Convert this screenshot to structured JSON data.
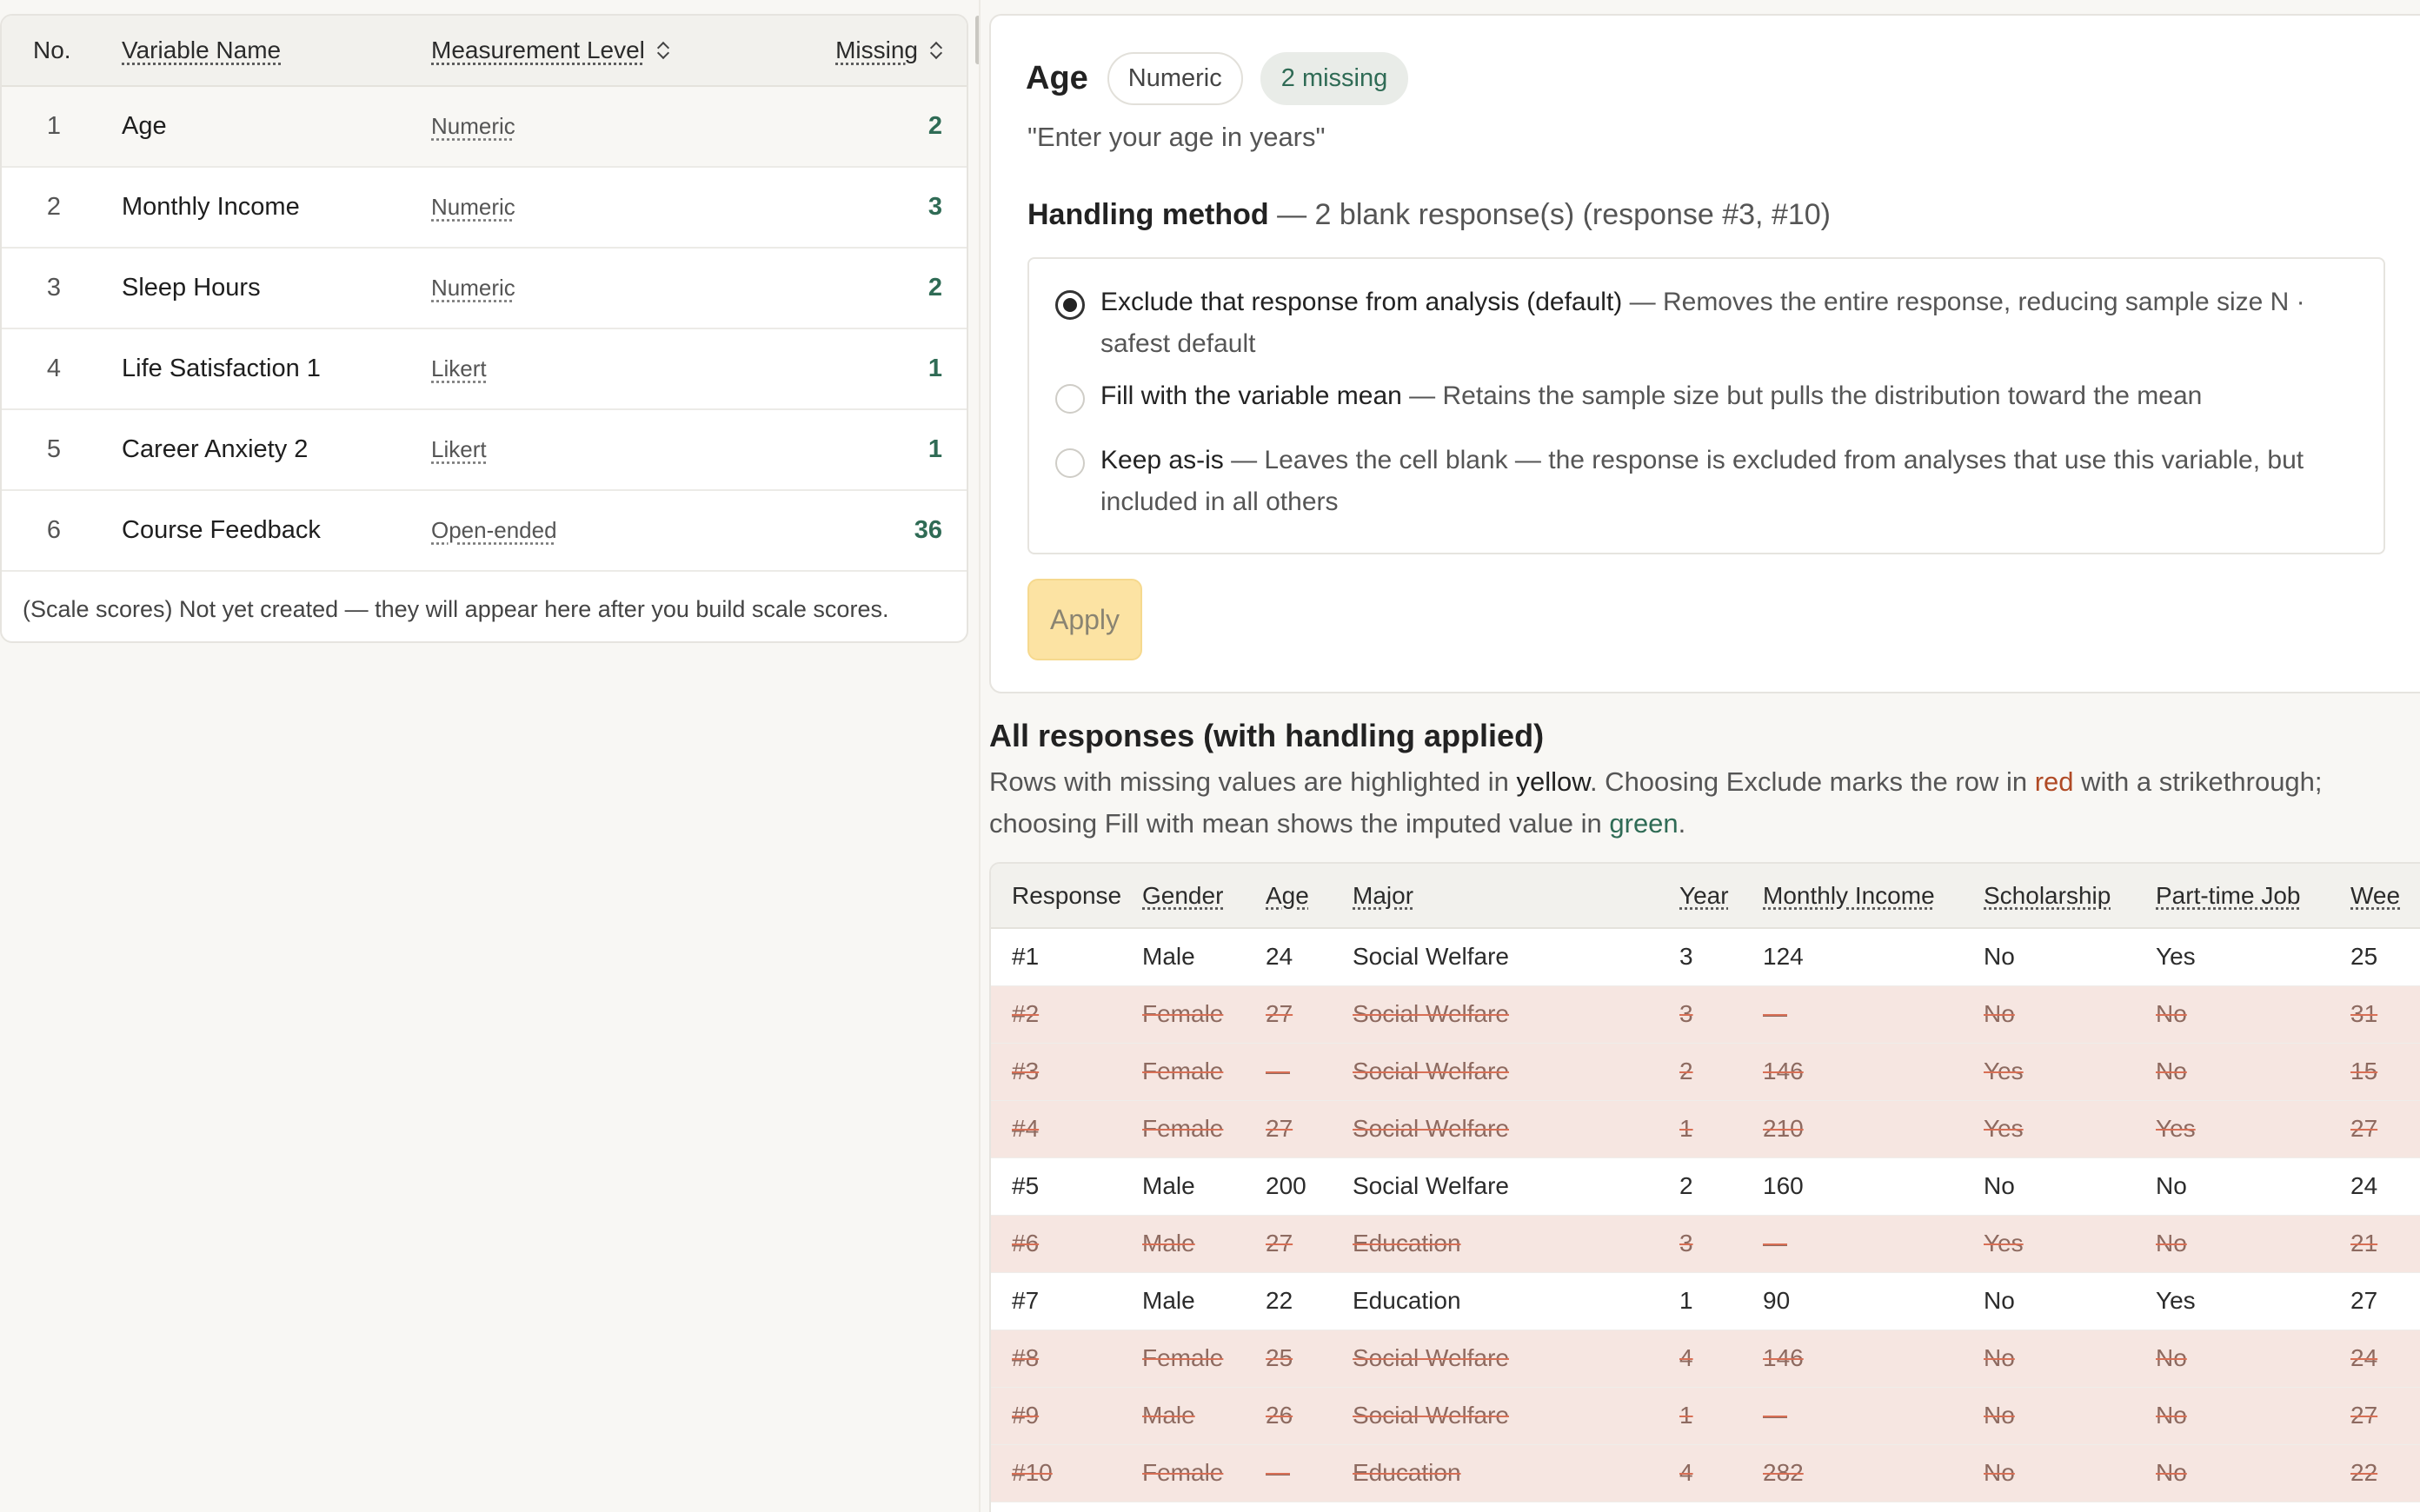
{
  "variables_table": {
    "headers": {
      "no": "No.",
      "name": "Variable Name",
      "level": "Measurement Level",
      "missing": "Missing"
    },
    "rows": [
      {
        "no": "1",
        "name": "Age",
        "level": "Numeric",
        "missing": "2"
      },
      {
        "no": "2",
        "name": "Monthly Income",
        "level": "Numeric",
        "missing": "3"
      },
      {
        "no": "3",
        "name": "Sleep Hours",
        "level": "Numeric",
        "missing": "2"
      },
      {
        "no": "4",
        "name": "Life Satisfaction 1",
        "level": "Likert",
        "missing": "1"
      },
      {
        "no": "5",
        "name": "Career Anxiety 2",
        "level": "Likert",
        "missing": "1"
      },
      {
        "no": "6",
        "name": "Course Feedback",
        "level": "Open-ended",
        "missing": "36"
      }
    ],
    "footer": "(Scale scores) Not yet created — they will appear here after you build scale scores."
  },
  "detail": {
    "title": "Age",
    "level_badge": "Numeric",
    "missing_badge": "2 missing",
    "question": "\"Enter your age in years\"",
    "handling_label": "Handling method",
    "handling_note": " — 2 blank response(s) (response #3, #10)",
    "options": [
      {
        "label": "Exclude that response from analysis (default)",
        "desc": " — Removes the entire response, reducing sample size N · safest default",
        "checked": true
      },
      {
        "label": "Fill with the variable mean",
        "desc": " — Retains the sample size but pulls the distribution toward the mean",
        "checked": false
      },
      {
        "label": "Keep as-is",
        "desc": " — Leaves the cell blank — the response is excluded from analyses that use this variable, but included in all others",
        "checked": false
      }
    ],
    "apply_label": "Apply"
  },
  "responses": {
    "title": "All responses (with handling applied)",
    "desc_1": "Rows with missing values are highlighted in ",
    "desc_yellow": "yellow",
    "desc_2": ". Choosing Exclude marks the row in ",
    "desc_red": "red",
    "desc_3": " with a strikethrough; choosing Fill with mean shows the imputed value in ",
    "desc_green": "green",
    "desc_4": ".",
    "columns": [
      "Response",
      "Gender",
      "Age",
      "Major",
      "Year",
      "Monthly Income",
      "Scholarship",
      "Part-time Job",
      "Wee"
    ],
    "rows": [
      {
        "cells": [
          "#1",
          "Male",
          "24",
          "Social Welfare",
          "3",
          "124",
          "No",
          "Yes",
          "25"
        ],
        "excluded": false
      },
      {
        "cells": [
          "#2",
          "Female",
          "27",
          "Social Welfare",
          "3",
          "—",
          "No",
          "No",
          "31"
        ],
        "excluded": true
      },
      {
        "cells": [
          "#3",
          "Female",
          "—",
          "Social Welfare",
          "2",
          "146",
          "Yes",
          "No",
          "15"
        ],
        "excluded": true
      },
      {
        "cells": [
          "#4",
          "Female",
          "27",
          "Social Welfare",
          "1",
          "210",
          "Yes",
          "Yes",
          "27"
        ],
        "excluded": true
      },
      {
        "cells": [
          "#5",
          "Male",
          "200",
          "Social Welfare",
          "2",
          "160",
          "No",
          "No",
          "24"
        ],
        "excluded": false
      },
      {
        "cells": [
          "#6",
          "Male",
          "27",
          "Education",
          "3",
          "—",
          "Yes",
          "No",
          "21"
        ],
        "excluded": true
      },
      {
        "cells": [
          "#7",
          "Male",
          "22",
          "Education",
          "1",
          "90",
          "No",
          "Yes",
          "27"
        ],
        "excluded": false
      },
      {
        "cells": [
          "#8",
          "Female",
          "25",
          "Social Welfare",
          "4",
          "146",
          "No",
          "No",
          "24"
        ],
        "excluded": true
      },
      {
        "cells": [
          "#9",
          "Male",
          "26",
          "Social Welfare",
          "1",
          "—",
          "No",
          "No",
          "27"
        ],
        "excluded": true
      },
      {
        "cells": [
          "#10",
          "Female",
          "—",
          "Education",
          "4",
          "282",
          "No",
          "No",
          "22"
        ],
        "excluded": true
      }
    ]
  },
  "colors": {
    "accent_green": "#2f6b55",
    "exclude_red": "#b04a25",
    "excluded_row_bg": "#f6e6e1",
    "apply_bg": "#fce3a3"
  }
}
